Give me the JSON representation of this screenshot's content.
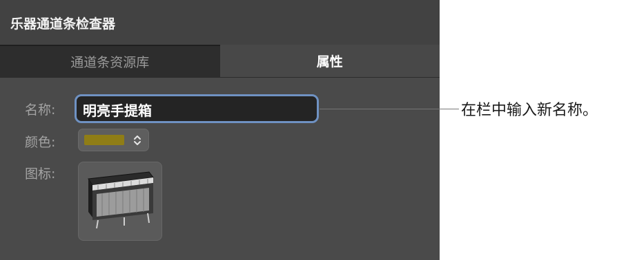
{
  "panel": {
    "title": "乐器通道条检查器",
    "tabs": [
      {
        "label": "通道条资源库",
        "active": false
      },
      {
        "label": "属性",
        "active": true
      }
    ]
  },
  "fields": {
    "name_label": "名称:",
    "name_value": "明亮手提箱",
    "color_label": "颜色:",
    "color_value": "#8f7d16",
    "icon_label": "图标:",
    "icon_name": "electric-piano-icon"
  },
  "callout": {
    "text": "在栏中输入新名称。"
  },
  "colors": {
    "focus_ring": "#6f92c3",
    "panel_bg": "#4a4a4a"
  }
}
